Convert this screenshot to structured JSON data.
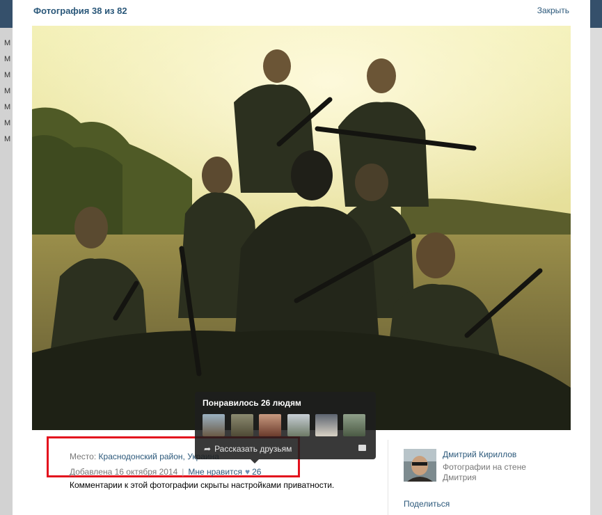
{
  "viewer": {
    "title": "Фотография 38 из 82",
    "close_label": "Закрыть"
  },
  "background": {
    "left_items": [
      "M",
      "M",
      "M",
      "M",
      "M",
      "M",
      "M"
    ]
  },
  "photo_info": {
    "place_label": "Место:",
    "place_value": "Краснодонский район, Украина",
    "added_label": "Добавлена 16 октября 2014",
    "separator": "|",
    "like_label": "Мне нравится",
    "like_icon": "heart-icon",
    "like_count": "26",
    "comments_hidden": "Комментарии к этой фотографии скрыты настройками приватности."
  },
  "likes_tooltip": {
    "title": "Понравилось 26 людям",
    "share_label": "Рассказать друзьям",
    "share_icon": "share-arrow-icon",
    "comment_icon": "comment-icon"
  },
  "author": {
    "name": "Дмитрий Кириллов",
    "desc_line1": "Фотографии на стене",
    "desc_line2": "Дмитрия"
  },
  "actions": {
    "share_label": "Поделиться"
  },
  "colors": {
    "link": "#2b587a",
    "highlight_border": "#e3111d"
  }
}
